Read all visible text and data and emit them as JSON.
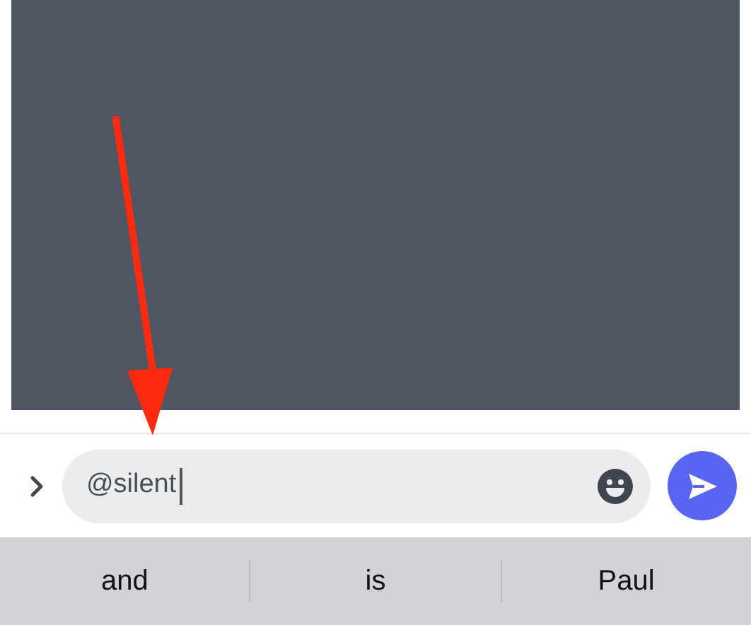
{
  "composer": {
    "value": "@silent"
  },
  "suggestions": [
    "and",
    "is",
    "Paul"
  ]
}
